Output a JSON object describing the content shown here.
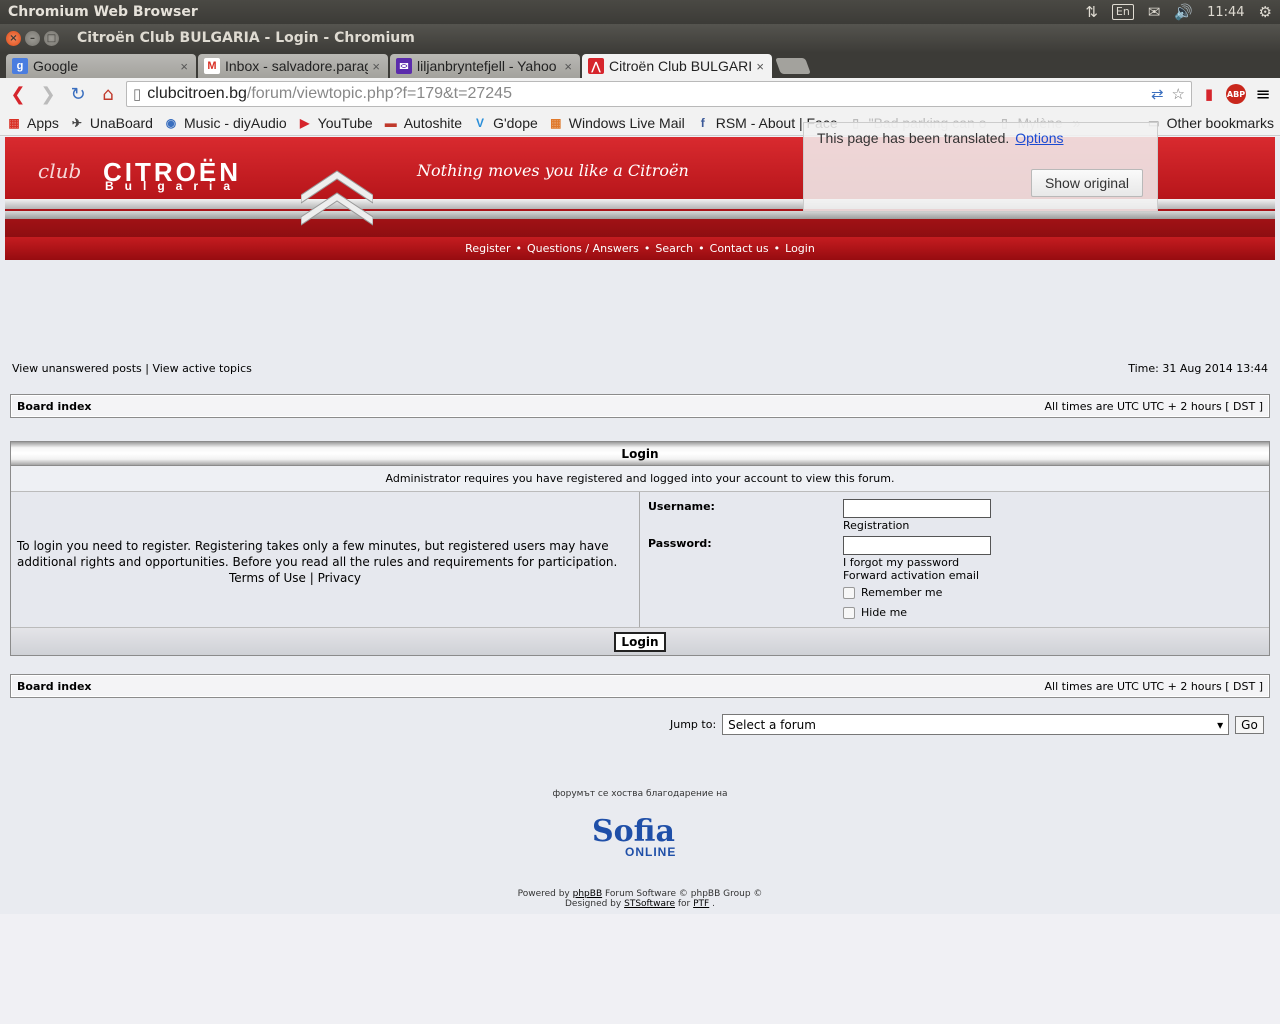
{
  "os": {
    "app_title": "Chromium Web Browser",
    "lang": "En",
    "clock": "11:44"
  },
  "window": {
    "title": "Citroën Club BULGARIA - Login - Chromium"
  },
  "tabs": [
    {
      "label": "Google",
      "fav": "g",
      "color": "#4a7de0"
    },
    {
      "label": "Inbox - salvadore.paragon",
      "fav": "M",
      "color": "#d93025"
    },
    {
      "label": "liljanbryntefjell - Yahoo",
      "fav": "✉",
      "color": "#5b2bac"
    },
    {
      "label": "Citroën Club BULGARIA",
      "fav": "⋀",
      "color": "#d6252c"
    }
  ],
  "omnibox": {
    "host": "clubcitroen.bg",
    "path": "/forum/viewtopic.php?f=179&t=27245"
  },
  "bookmarks": [
    {
      "label": "Apps",
      "icon": "▦",
      "color": "#d93025"
    },
    {
      "label": "UnaBoard",
      "icon": "✈",
      "color": "#444"
    },
    {
      "label": "Music - diyAudio",
      "icon": "◉",
      "color": "#3a6fbf"
    },
    {
      "label": "YouTube",
      "icon": "▶",
      "color": "#d6252c"
    },
    {
      "label": "Autoshite",
      "icon": "▬",
      "color": "#c0392b"
    },
    {
      "label": "G'dope",
      "icon": "V",
      "color": "#2b8fd9"
    },
    {
      "label": "Windows Live Mail",
      "icon": "▦",
      "color": "#e0792b"
    },
    {
      "label": "RSM - About | Face",
      "icon": "f",
      "color": "#3b5998"
    },
    {
      "label": "\"Bad parking can o",
      "icon": "▯",
      "color": "#bbb"
    },
    {
      "label": "Mylène",
      "icon": "▯",
      "color": "#bbb"
    }
  ],
  "bookmarks_more": "»",
  "other_bookmarks": "Other bookmarks",
  "translate": {
    "message": "This page has been translated.",
    "options": "Options",
    "show_original": "Show original"
  },
  "banner": {
    "club": "club",
    "brand": "CITROËN",
    "brand_sub": "Bulgaria",
    "slogan": "Nothing moves you like a Citroën"
  },
  "nav": [
    "Register",
    "Questions / Answers",
    "Search",
    "Contact us",
    "Login"
  ],
  "links": {
    "unanswered": "View unanswered posts",
    "active": "View active topics",
    "time": "Time: 31 Aug 2014 13:44"
  },
  "crumb": {
    "board_index": "Board index",
    "timezone": "All times are UTC UTC + 2 hours [ DST ]"
  },
  "login": {
    "title": "Login",
    "info": "Administrator requires you have registered and logged into your account to view this forum.",
    "left_text": "To login you need to register. Registering takes only a few minutes, but registered users may have additional rights and opportunities. Before you read all the rules and requirements for participation.",
    "terms": "Terms of Use",
    "privacy": "Privacy",
    "username_label": "Username:",
    "registration": "Registration",
    "password_label": "Password:",
    "forgot": "I forgot my password",
    "forward": "Forward activation email",
    "remember": "Remember me",
    "hide": "Hide me",
    "button": "Login"
  },
  "jump": {
    "label": "Jump to:",
    "selected": "Select a forum",
    "go": "Go"
  },
  "footer": {
    "hosted": "форумът се хоства благодарение на",
    "sofia": "Sofia",
    "online": "ONLINE",
    "powered_pre": "Powered by",
    "phpbb": "phpBB",
    "powered_post": "Forum Software © phpBB Group ©",
    "designed_pre": "Designed by",
    "stsoftware": "STSoftware",
    "for": "for",
    "ptf": "PTF",
    "dot": "."
  }
}
